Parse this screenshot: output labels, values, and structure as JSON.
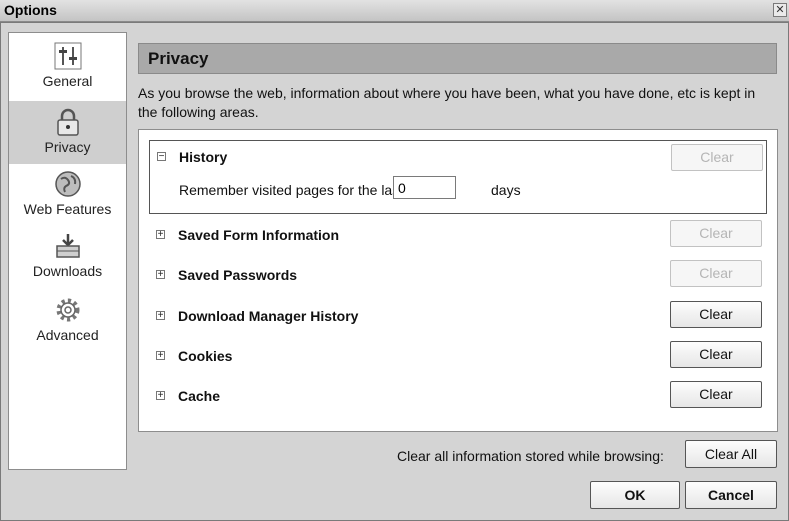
{
  "window": {
    "title": "Options",
    "close_glyph": "✕"
  },
  "sidebar": {
    "categories": [
      {
        "label": "General",
        "icon": "sliders-icon",
        "selected": false
      },
      {
        "label": "Privacy",
        "icon": "padlock-icon",
        "selected": true
      },
      {
        "label": "Web Features",
        "icon": "globe-icon",
        "selected": false
      },
      {
        "label": "Downloads",
        "icon": "download-tray-icon",
        "selected": false
      },
      {
        "label": "Advanced",
        "icon": "gear-icon",
        "selected": false
      }
    ]
  },
  "pane": {
    "title": "Privacy",
    "intro": "As you browse the web, information about where you have been, what you have done, etc is kept in the following areas."
  },
  "items": [
    {
      "label": "History",
      "expanded": true,
      "toggle": "−",
      "clear_label": "Clear",
      "clear_enabled": false,
      "detail_prefix": "Remember visited pages for the last",
      "days_value": "0",
      "days_suffix": "days"
    },
    {
      "label": "Saved Form Information",
      "expanded": false,
      "toggle": "+",
      "clear_label": "Clear",
      "clear_enabled": false
    },
    {
      "label": "Saved Passwords",
      "expanded": false,
      "toggle": "+",
      "clear_label": "Clear",
      "clear_enabled": false
    },
    {
      "label": "Download Manager History",
      "expanded": false,
      "toggle": "+",
      "clear_label": "Clear",
      "clear_enabled": true
    },
    {
      "label": "Cookies",
      "expanded": false,
      "toggle": "+",
      "clear_label": "Clear",
      "clear_enabled": true
    },
    {
      "label": "Cache",
      "expanded": false,
      "toggle": "+",
      "clear_label": "Clear",
      "clear_enabled": true
    }
  ],
  "footer": {
    "clear_all_text": "Clear all information stored while browsing:",
    "clear_all_label": "Clear All",
    "ok_label": "OK",
    "cancel_label": "Cancel"
  }
}
